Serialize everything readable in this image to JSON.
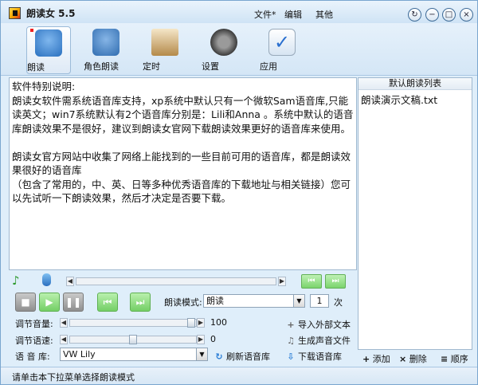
{
  "app": {
    "title": "朗读女 5.5"
  },
  "menu": {
    "file": "文件*",
    "edit": "编辑",
    "other": "其他"
  },
  "window_controls": {
    "pin": "↻",
    "minimize": "−",
    "maximize": "□",
    "close": "×"
  },
  "toolbar": {
    "items": [
      {
        "label": "朗读",
        "icon": "person-icon",
        "color": "#2a70bf"
      },
      {
        "label": "角色朗读",
        "icon": "group-icon",
        "color": "#2f6cb0"
      },
      {
        "label": "定时",
        "icon": "hourglass-icon",
        "color": "#b48a4a"
      },
      {
        "label": "设置",
        "icon": "gear-icon",
        "color": "#3c3c3c"
      },
      {
        "label": "应用",
        "icon": "checkmark-icon",
        "color": "#2a6fcf"
      }
    ]
  },
  "text": {
    "lines": [
      "软件特别说明:",
      "朗读女软件需系统语音库支持，xp系统中默认只有一个微软Sam语音库,只能读英文；win7系统默认有2个语音库分别是：Lili和Anna 。系统中默认的语音库朗读效果不是很好，建议到朗读女官网下载朗读效果更好的语音库来使用。",
      "",
      "朗读女官方网站中收集了网络上能找到的一些目前可用的语音库，都是朗读效果很好的语音库",
      "（包含了常用的，中、英、日等多种优秀语音库的下载地址与相关链接）您可以先试听一下朗读效果，然后才决定是否要下载。"
    ]
  },
  "playlist": {
    "header": "默认朗读列表",
    "items": [
      "朗读演示文稿.txt"
    ],
    "add": "添加",
    "delete": "删除",
    "order": "顺序"
  },
  "controls": {
    "mode_label": "朗读模式:",
    "mode_value": "朗读",
    "repeat_value": "1",
    "repeat_unit": "次",
    "volume_label": "调节音量:",
    "volume_value": "100",
    "speed_label": "调节语速:",
    "speed_value": "0",
    "voice_label": "语 音 库:",
    "voice_value": "VW Lily",
    "refresh_voice": "刷新语音库",
    "import_text": "导入外部文本",
    "generate_audio": "生成声音文件",
    "download_voice": "下载语音库"
  },
  "status": {
    "text": "请单击本下拉菜单选择朗读模式"
  }
}
